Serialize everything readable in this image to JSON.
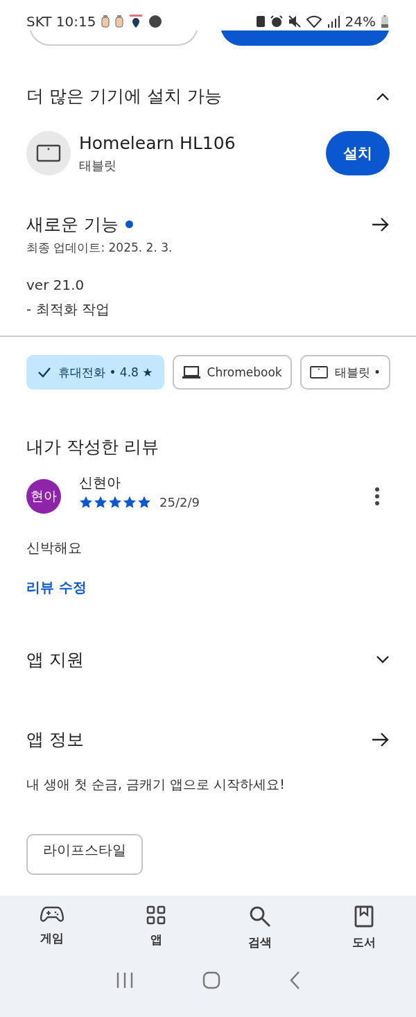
{
  "status_bar": {
    "carrier": "SKT",
    "time": "10:15",
    "battery": "24%"
  },
  "more_devices": {
    "title": "더 많은 기기에 설치 가능",
    "expanded": true,
    "device": {
      "name": "Homelearn HL106",
      "type": "태블릿",
      "button": "설치"
    }
  },
  "whats_new": {
    "title": "새로운 기능",
    "new_dot": true,
    "updated": "최종 업데이트: 2025. 2. 3.",
    "version": "ver 21.0",
    "notes": "- 최적화 작업"
  },
  "device_filters": [
    {
      "label": "휴대전화 • 4.8 ★",
      "selected": true
    },
    {
      "kind": "laptop",
      "label": "Chromebook",
      "selected": false
    },
    {
      "kind": "tablet",
      "label": "태블릿 •",
      "selected": false
    }
  ],
  "my_review": {
    "title": "내가 작성한 리뷰",
    "author": "신현아",
    "avatar": "현아",
    "color": "#8e24aa",
    "stars": 5,
    "date": "25/2/9",
    "text": "신박해요",
    "edit_link": "리뷰 수정"
  },
  "app_support": {
    "title": "앱 지원",
    "expanded": false
  },
  "app_info": {
    "title": "앱 정보",
    "description": "내 생애 첫 순금, 금캐기 앱으로 시작하세요!",
    "tags": [
      "라이프스타일"
    ]
  },
  "bottom_nav": [
    {
      "kind": "games",
      "label": "게임"
    },
    {
      "kind": "apps",
      "label": "앱"
    },
    {
      "kind": "search",
      "label": "검색"
    },
    {
      "kind": "books",
      "label": "도서"
    }
  ]
}
